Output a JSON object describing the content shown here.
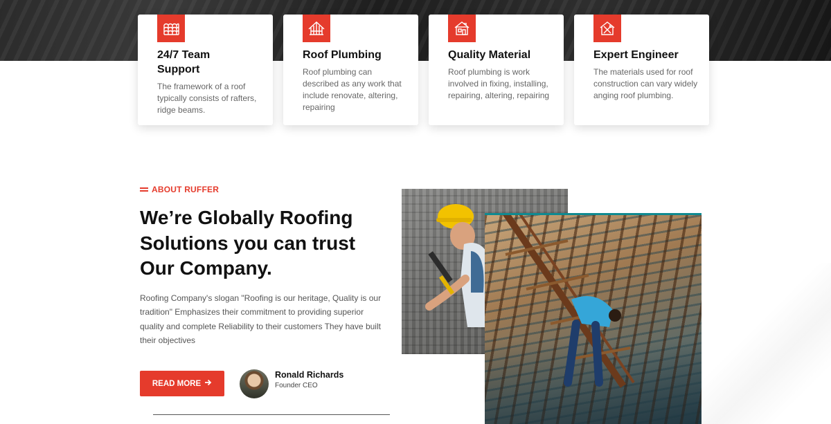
{
  "features": [
    {
      "title": "24/7 Team Support",
      "title_line1": "24/7 Team",
      "title_line2": "Support",
      "text": "The framework of a roof typically consists of rafters, ridge beams.",
      "icon": "roof-tiles-icon"
    },
    {
      "title": "Roof Plumbing",
      "text": "Roof plumbing can described as any work that include renovate, altering, repairing",
      "icon": "roof-frame-icon"
    },
    {
      "title": "Quality Material",
      "text": "Roof plumbing is work involved in fixing, installing, repairing, altering, repairing",
      "icon": "house-icon"
    },
    {
      "title": "Expert Engineer",
      "text": "The materials used for roof construction can vary widely anging roof plumbing.",
      "icon": "house-tools-icon"
    }
  ],
  "about": {
    "eyebrow": "ABOUT RUFFER",
    "headline": "We’re Globally Roofing Solutions you can trust Our Company.",
    "body": "Roofing Company's slogan \"Roofing is our heritage, Quality is our tradition\" Emphasizes their commitment to providing superior quality and complete Reliability to their customers They have built their objectives",
    "read_more_label": "READ MORE",
    "author_name": "Ronald Richards",
    "author_role": "Founder CEO"
  },
  "colors": {
    "accent": "#e53b2c",
    "heading": "#111111",
    "body": "#555555"
  }
}
